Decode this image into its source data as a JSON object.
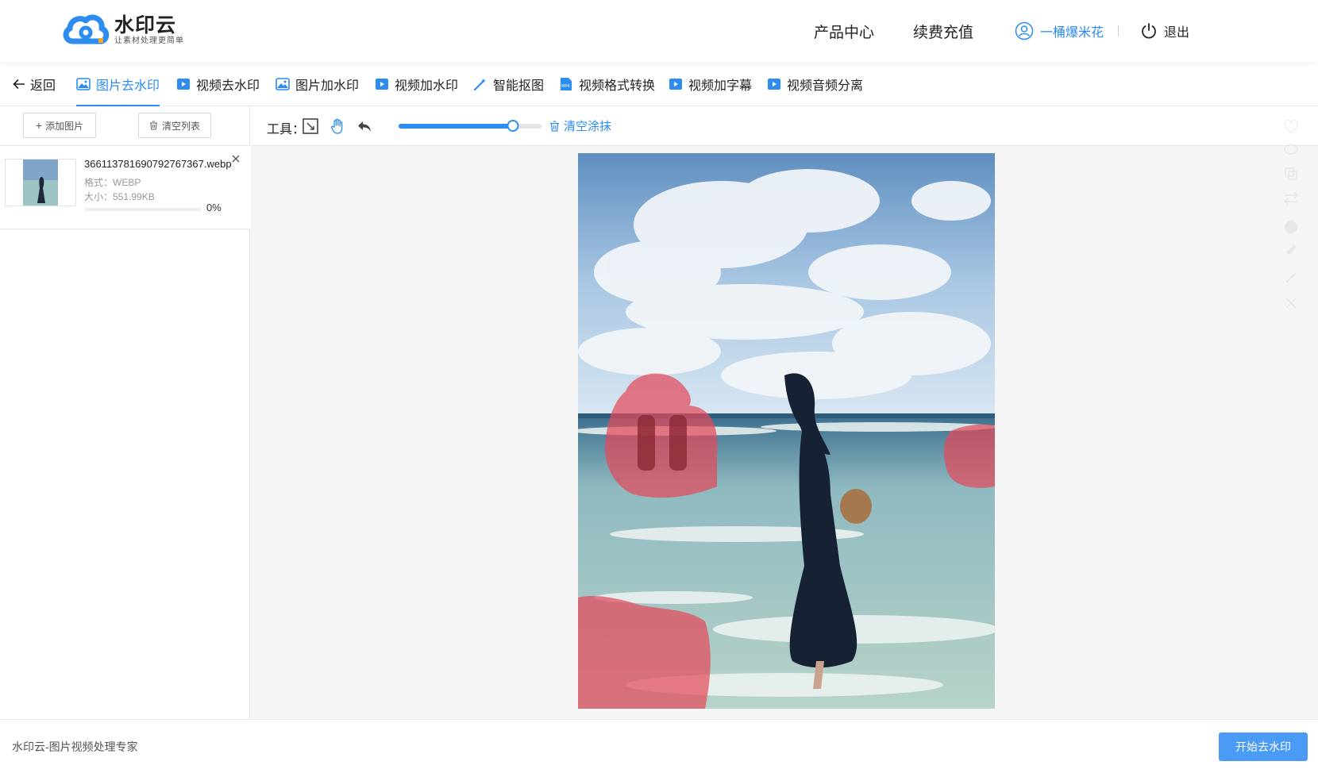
{
  "brand": {
    "name": "水印云",
    "slogan": "让素材处理更简单"
  },
  "header": {
    "products": "产品中心",
    "recharge": "续费充值",
    "username": "一桶爆米花",
    "logout": "退出"
  },
  "tabs": {
    "back": "返回",
    "items": [
      "图片去水印",
      "视频去水印",
      "图片加水印",
      "视频加水印",
      "智能抠图",
      "视频格式转换",
      "视频加字幕",
      "视频音频分离"
    ],
    "active": "图片去水印"
  },
  "left": {
    "add_label": "添加图片",
    "clear_label": "清空列表",
    "file": {
      "name": "36611378169079276736​7.webp",
      "format": "格式：WEBP",
      "size": "大小：551.99KB",
      "progress_text": "0%",
      "progress": 0
    }
  },
  "toolbar": {
    "label": "工具：",
    "clear_paint": "清空涂抹",
    "brush_size": 0.8
  },
  "footer": {
    "text": "水印云-图片视频处理专家",
    "start_button": "开始去水印"
  },
  "colors": {
    "accent": "#2d8cf0",
    "mask": "#e34a5a",
    "button": "#4a9bf5"
  },
  "icons": {
    "header": [
      "user-icon",
      "power-icon"
    ],
    "tools": [
      "rect-select-icon",
      "hand-icon",
      "undo-icon",
      "trash-icon"
    ]
  }
}
